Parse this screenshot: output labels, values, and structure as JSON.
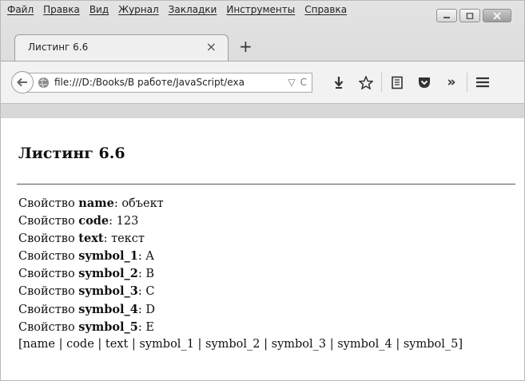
{
  "menu": [
    "Файл",
    "Правка",
    "Вид",
    "Журнал",
    "Закладки",
    "Инструменты",
    "Справка"
  ],
  "tab": {
    "title": "Листинг 6.6",
    "close": "×"
  },
  "newtab": "+",
  "url": {
    "text": "file:///D:/Books/В работе/JavaScript/exa",
    "dropdown": "▽",
    "reload": "C"
  },
  "toolbar": {
    "more": "»"
  },
  "page": {
    "heading": "Листинг 6.6",
    "prefix": "Свойство",
    "properties": [
      {
        "key": "name",
        "value": "объект"
      },
      {
        "key": "code",
        "value": "123"
      },
      {
        "key": "text",
        "value": "текст"
      },
      {
        "key": "symbol_1",
        "value": "A"
      },
      {
        "key": "symbol_2",
        "value": "B"
      },
      {
        "key": "symbol_3",
        "value": "C"
      },
      {
        "key": "symbol_4",
        "value": "D"
      },
      {
        "key": "symbol_5",
        "value": "E"
      }
    ],
    "keys_list": "[name | code | text | symbol_1 | symbol_2 | symbol_3 | symbol_4 | symbol_5]"
  }
}
